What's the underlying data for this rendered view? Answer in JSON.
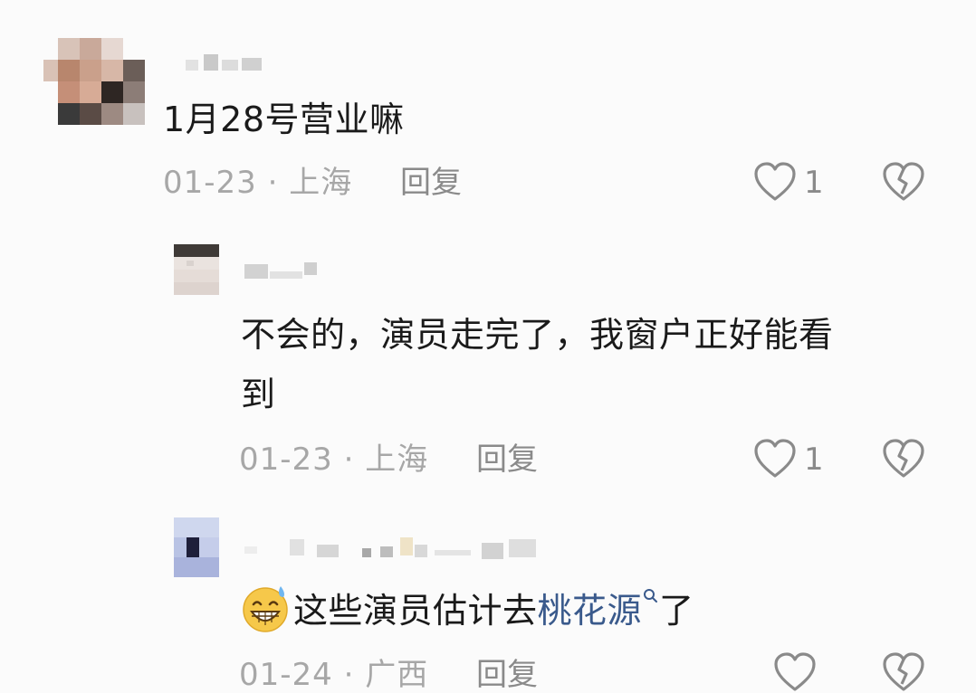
{
  "comments": [
    {
      "text": "1月28号营业嘛",
      "meta": "01-23 · 上海",
      "reply_label": "回复",
      "like_count": "1"
    },
    {
      "text_line1": "不会的，演员走完了，我窗户正好能看",
      "text_line2": "到",
      "meta": "01-23 · 上海",
      "reply_label": "回复",
      "like_count": "1"
    },
    {
      "text_before_link": "这些演员估计去",
      "link_text": "桃花源",
      "text_after_link": "了",
      "meta": "01-24 · 广西",
      "reply_label": "回复",
      "like_count": ""
    }
  ]
}
